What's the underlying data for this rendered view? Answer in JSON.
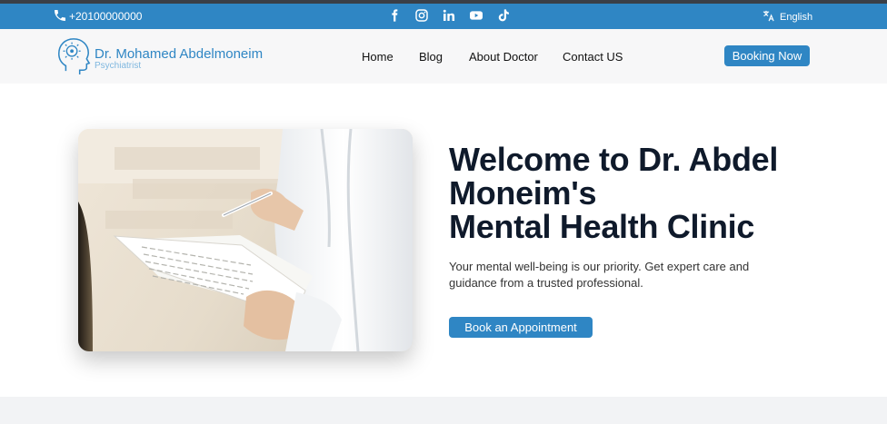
{
  "topbar": {
    "phone": "+20100000000",
    "language": "English",
    "icons": [
      "phone-icon",
      "facebook-icon",
      "instagram-icon",
      "linkedin-icon",
      "youtube-icon",
      "tiktok-icon",
      "translate-icon"
    ]
  },
  "header": {
    "logo_name": "Dr. Mohamed Abdelmoneim",
    "logo_subtitle": "Psychiatrist",
    "nav": [
      {
        "label": "Home"
      },
      {
        "label": "Blog"
      },
      {
        "label": "About Doctor"
      },
      {
        "label": "Contact US"
      }
    ],
    "cta_label": "Booking Now"
  },
  "hero": {
    "title_lines": [
      "Welcome to Dr. Abdel",
      "Moneim's",
      "Mental Health Clinic"
    ],
    "description": "Your mental well-being is our priority. Get expert care and guidance from a trusted professional.",
    "button_label": "Book an Appointment"
  },
  "colors": {
    "brand_blue": "#2f86c4",
    "title_dark": "#0f1a2b",
    "nav_background": "#f7f7f8"
  }
}
